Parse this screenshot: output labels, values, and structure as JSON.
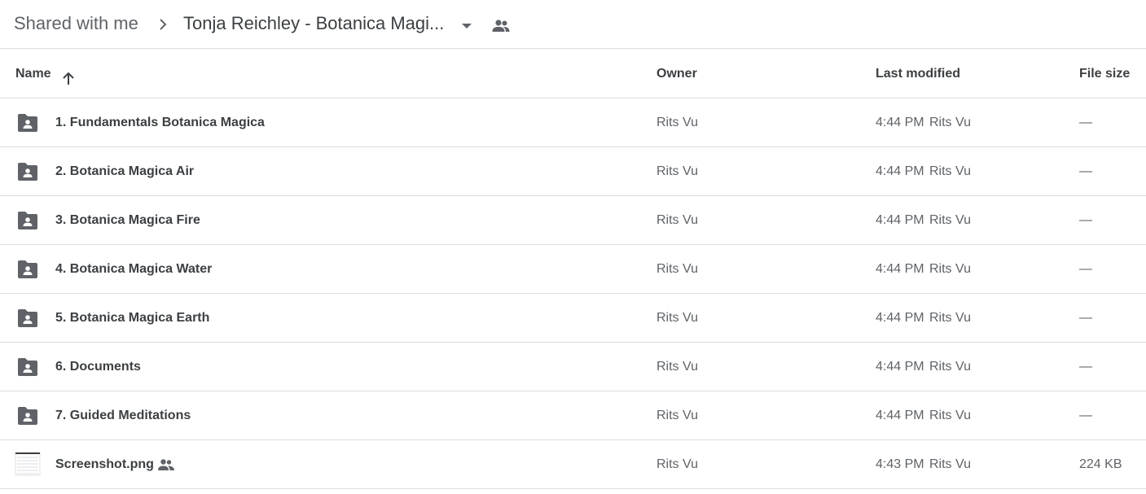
{
  "breadcrumb": {
    "root": "Shared with me",
    "separator_icon": "chevron-right-icon",
    "current": "Tonja Reichley - Botanica Magi...",
    "dropdown_icon": "arrow-drop-down-icon",
    "shared_icon": "people-icon"
  },
  "columns": {
    "name": "Name",
    "owner": "Owner",
    "last_modified": "Last modified",
    "file_size": "File size",
    "sort_icon": "arrow-up-icon"
  },
  "colors": {
    "text_primary": "#3c4043",
    "text_secondary": "#5f6368",
    "divider": "#dadce0",
    "folder_icon": "#5f6368"
  },
  "files": [
    {
      "icon": "shared-folder-icon",
      "name": "1. Fundamentals Botanica Magica",
      "owner": "Rits Vu",
      "modified_time": "4:44 PM",
      "modified_by": "Rits Vu",
      "size": "—"
    },
    {
      "icon": "shared-folder-icon",
      "name": "2. Botanica Magica Air",
      "owner": "Rits Vu",
      "modified_time": "4:44 PM",
      "modified_by": "Rits Vu",
      "size": "—"
    },
    {
      "icon": "shared-folder-icon",
      "name": "3. Botanica Magica Fire",
      "owner": "Rits Vu",
      "modified_time": "4:44 PM",
      "modified_by": "Rits Vu",
      "size": "—"
    },
    {
      "icon": "shared-folder-icon",
      "name": "4. Botanica Magica Water",
      "owner": "Rits Vu",
      "modified_time": "4:44 PM",
      "modified_by": "Rits Vu",
      "size": "—"
    },
    {
      "icon": "shared-folder-icon",
      "name": "5. Botanica Magica Earth",
      "owner": "Rits Vu",
      "modified_time": "4:44 PM",
      "modified_by": "Rits Vu",
      "size": "—"
    },
    {
      "icon": "shared-folder-icon",
      "name": "6. Documents",
      "owner": "Rits Vu",
      "modified_time": "4:44 PM",
      "modified_by": "Rits Vu",
      "size": "—"
    },
    {
      "icon": "shared-folder-icon",
      "name": "7. Guided Meditations",
      "owner": "Rits Vu",
      "modified_time": "4:44 PM",
      "modified_by": "Rits Vu",
      "size": "—"
    },
    {
      "icon": "image-thumbnail-icon",
      "name": "Screenshot.png",
      "shared_badge_icon": "people-icon",
      "owner": "Rits Vu",
      "modified_time": "4:43 PM",
      "modified_by": "Rits Vu",
      "size": "224 KB"
    }
  ]
}
